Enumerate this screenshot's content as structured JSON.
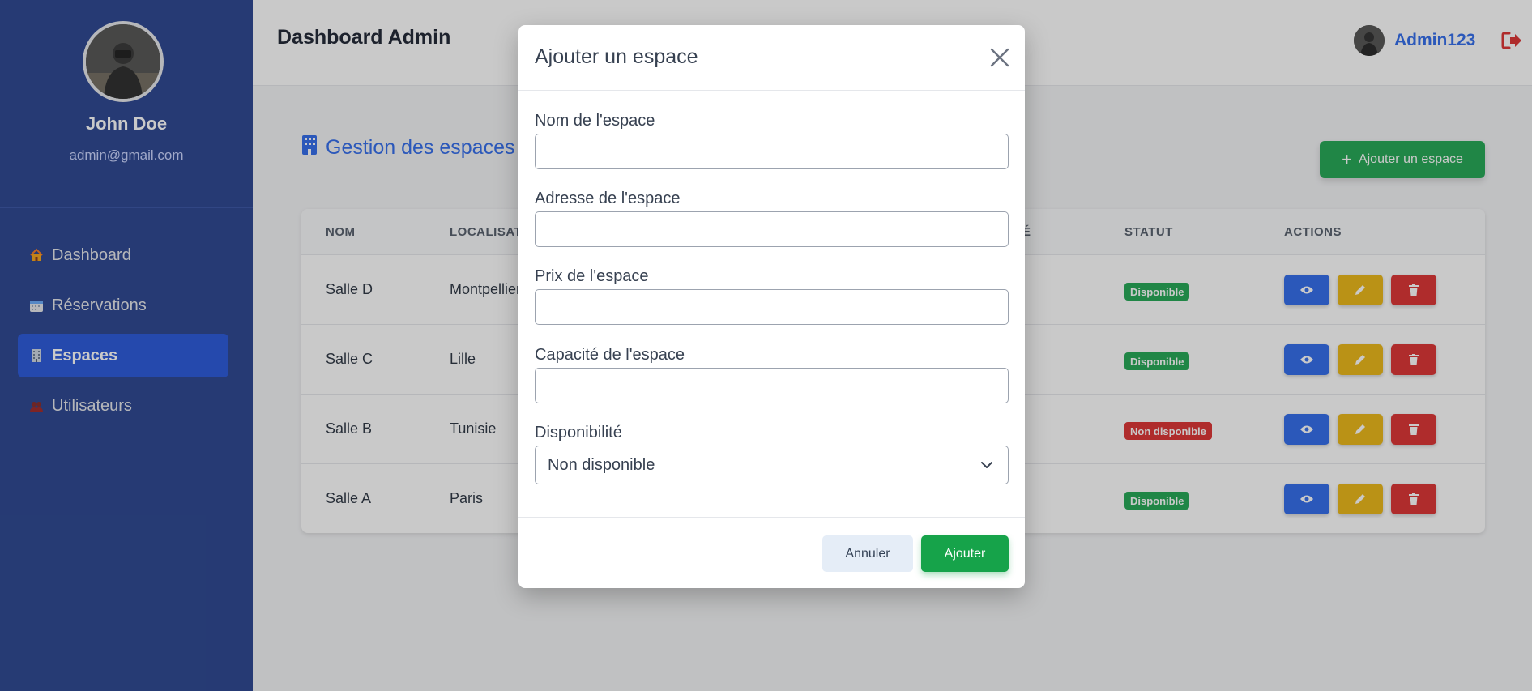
{
  "sidebar": {
    "profile": {
      "name": "John Doe",
      "email": "admin@gmail.com"
    },
    "items": [
      {
        "label": "Dashboard",
        "icon": "house-icon",
        "active": false
      },
      {
        "label": "Réservations",
        "icon": "calendar-icon",
        "active": false
      },
      {
        "label": "Espaces",
        "icon": "building-icon",
        "active": true
      },
      {
        "label": "Utilisateurs",
        "icon": "users-icon",
        "active": false
      }
    ]
  },
  "header": {
    "title": "Dashboard Admin",
    "username": "Admin123"
  },
  "main": {
    "section_title": "Gestion des espaces",
    "add_button_label": "Ajouter un espace",
    "table": {
      "columns": [
        "NOM",
        "LOCALISAT",
        "É",
        "STATUT",
        "ACTIONS"
      ],
      "rows": [
        {
          "nom": "Salle D",
          "localisation": "Montpellier",
          "hidden_col": ")",
          "statut": "Disponible",
          "available": true
        },
        {
          "nom": "Salle C",
          "localisation": "Lille",
          "hidden_col": ")",
          "statut": "Disponible",
          "available": true
        },
        {
          "nom": "Salle B",
          "localisation": "Tunisie",
          "hidden_col": "",
          "statut": "Non disponible",
          "available": false
        },
        {
          "nom": "Salle A",
          "localisation": "Paris",
          "hidden_col": ")",
          "statut": "Disponible",
          "available": true
        }
      ]
    }
  },
  "modal": {
    "title": "Ajouter un espace",
    "fields": {
      "nom_label": "Nom de l'espace",
      "adresse_label": "Adresse de l'espace",
      "prix_label": "Prix de l'espace",
      "capacite_label": "Capacité de l'espace",
      "disponibilite_label": "Disponibilité",
      "disponibilite_value": "Non disponible"
    },
    "cancel_label": "Annuler",
    "submit_label": "Ajouter"
  },
  "colors": {
    "sidebar_bg": "#1e3a8a",
    "active_nav": "#1d4ed8",
    "primary": "#2563eb",
    "success": "#16a34a",
    "warning": "#eab308",
    "danger": "#dc2626"
  }
}
